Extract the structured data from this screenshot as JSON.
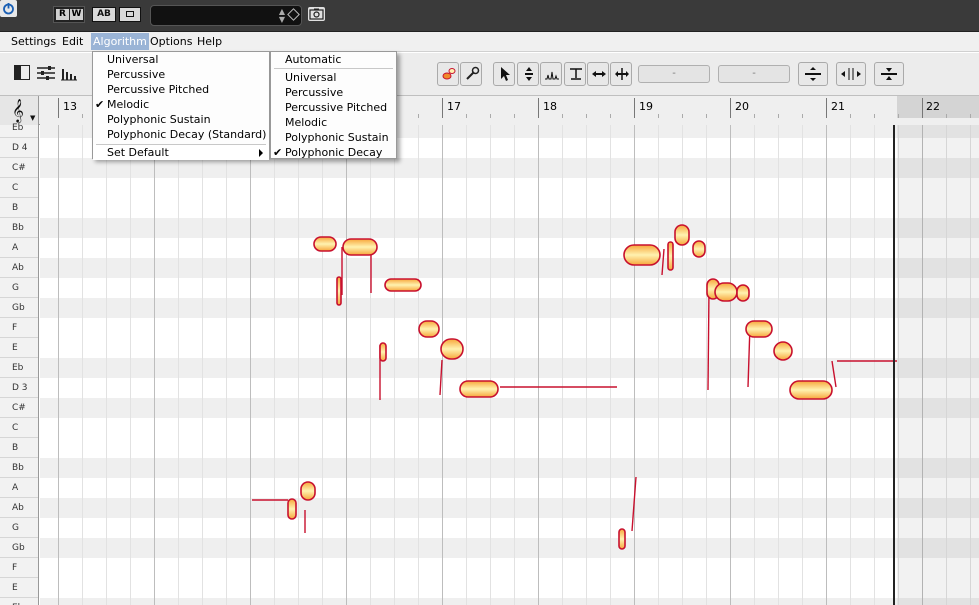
{
  "window": {
    "transport_value": "",
    "buttons": {
      "r": "R",
      "w": "W",
      "ab": "AB"
    }
  },
  "menubar": {
    "settings": "Settings",
    "edit": "Edit",
    "algorithm": "Algorithm",
    "options": "Options",
    "help": "Help"
  },
  "algorithm_menu": {
    "items": [
      {
        "label": "Universal",
        "checked": false
      },
      {
        "label": "Percussive",
        "checked": false
      },
      {
        "label": "Percussive Pitched",
        "checked": false
      },
      {
        "label": "Melodic",
        "checked": true
      },
      {
        "label": "Polyphonic Sustain",
        "checked": false
      },
      {
        "label": "Polyphonic Decay (Standard)",
        "checked": false
      }
    ],
    "set_default": "Set Default",
    "check_glyph": "✔"
  },
  "default_submenu": {
    "automatic": "Automatic",
    "items": [
      {
        "label": "Universal",
        "checked": false
      },
      {
        "label": "Percussive",
        "checked": false
      },
      {
        "label": "Percussive Pitched",
        "checked": false
      },
      {
        "label": "Melodic",
        "checked": false
      },
      {
        "label": "Polyphonic Sustain",
        "checked": false
      },
      {
        "label": "Polyphonic Decay",
        "checked": true
      }
    ]
  },
  "toolbar": {
    "field_1": "-",
    "field_2": "-"
  },
  "ruler": {
    "bars": [
      "13",
      "17",
      "18",
      "19",
      "20",
      "21",
      "22"
    ]
  },
  "piano_keys": [
    "Eb",
    "D 4",
    "C#",
    "C",
    "B",
    "Bb",
    "A",
    "Ab",
    "G",
    "Gb",
    "F",
    "E",
    "Eb",
    "D 3",
    "C#",
    "C",
    "B",
    "Bb",
    "A",
    "Ab",
    "G",
    "Gb",
    "F",
    "E",
    "Eb"
  ],
  "colors": {
    "blob_outer": "#c8102e",
    "blob_mid": "#f08a2a",
    "blob_inner": "#fff2b0",
    "menu_highlight": "#9ab4d6"
  }
}
